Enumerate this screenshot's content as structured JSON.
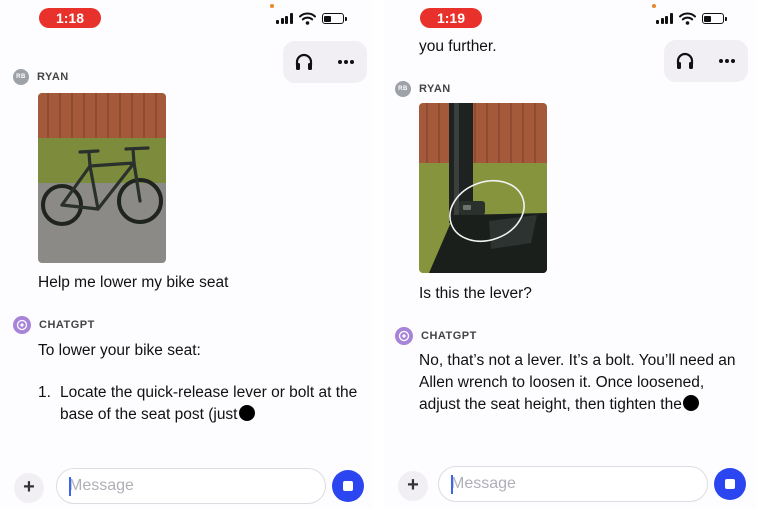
{
  "left": {
    "time": "1:18",
    "user": {
      "avatar": "RB",
      "name": "RYAN",
      "message": "Help me lower my bike seat",
      "image_icon": "bike-photo"
    },
    "assistant": {
      "name": "CHATGPT",
      "intro": "To lower your bike seat:",
      "list_number": "1.",
      "list_text": "Locate the quick-release lever or bolt at the base of the seat post (just"
    },
    "composer": {
      "placeholder": "Message",
      "plus_label": "+"
    }
  },
  "right": {
    "time": "1:19",
    "top_fragment": "you further.",
    "user": {
      "avatar": "RB",
      "name": "RYAN",
      "message": "Is this the lever?",
      "image_icon": "seat-post-photo"
    },
    "assistant": {
      "name": "CHATGPT",
      "reply": "No, that’s not a lever. It’s a bolt. You’ll need an Allen wrench to loosen it. Once loosened, adjust the seat height, then tighten the"
    },
    "composer": {
      "placeholder": "Message",
      "plus_label": "+"
    }
  },
  "icons": {
    "headphones": "headphones-icon",
    "more": "more-icon",
    "signal": "signal-icon",
    "wifi": "wifi-icon",
    "battery": "battery-icon",
    "stop": "stop-icon"
  },
  "colors": {
    "time_pill": "#e8312b",
    "stop_button": "#2b46f0",
    "chatgpt_avatar": "#a784d8"
  }
}
